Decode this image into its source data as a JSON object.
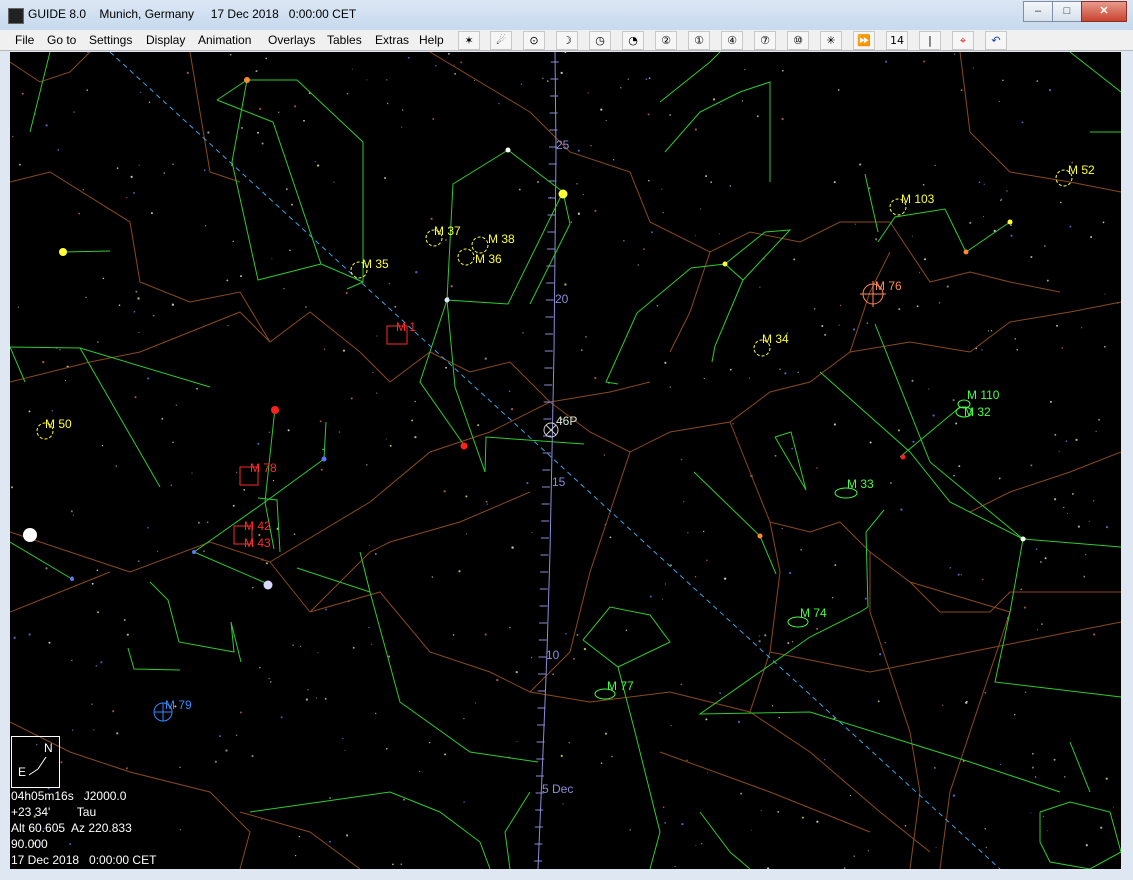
{
  "window": {
    "title": "GUIDE 8.0    Munich, Germany     17 Dec 2018   0:00:00 CET",
    "minimize": "–",
    "maximize": "□",
    "close": "✕"
  },
  "menu": [
    "File",
    "Go to",
    "Settings",
    "Display",
    "Animation",
    "Overlays",
    "Tables",
    "Extras",
    "Help"
  ],
  "toolbar": [
    "✶",
    "☄",
    "⊙",
    "☽",
    "◷",
    "◔",
    "②",
    "①",
    "④",
    "⑦",
    "⑩",
    "✳",
    "⏩",
    "14",
    "|",
    "⌖",
    "↶"
  ],
  "objects": {
    "m35": "M 35",
    "m37": "M 37",
    "m38": "M 38",
    "m36": "M 36",
    "m1": "M 1",
    "m50": "M 50",
    "m78": "M 78",
    "m42": "M 42",
    "m43": "M 43",
    "m79": "M 79",
    "m103": "M 103",
    "m52": "M 52",
    "m76": "M 76",
    "m34": "M 34",
    "m110": "M 110",
    "m32": "M 32",
    "m33": "M 33",
    "m74": "M 74",
    "m77": "M 77",
    "comet": "46P"
  },
  "track_labels": {
    "d25": "25",
    "d20": "20",
    "d15": "15",
    "d10": "10",
    "d5": "5 Dec"
  },
  "compass": {
    "n": "N",
    "e": "E"
  },
  "info": {
    "ra": "04h05m16s   J2000.0",
    "dec": "+23 34'        Tau",
    "altaz": "Alt 60.605  Az 220.833",
    "fov": "90.000",
    "datetime": "17 Dec 2018   0:00:00 CET"
  },
  "colors": {
    "sky": "#000000",
    "constellation_lines": "#2ecc2e",
    "boundaries": "#8a4a1c",
    "ecliptic": "#3ba3e6",
    "comet_track": "#8c8cd9"
  }
}
